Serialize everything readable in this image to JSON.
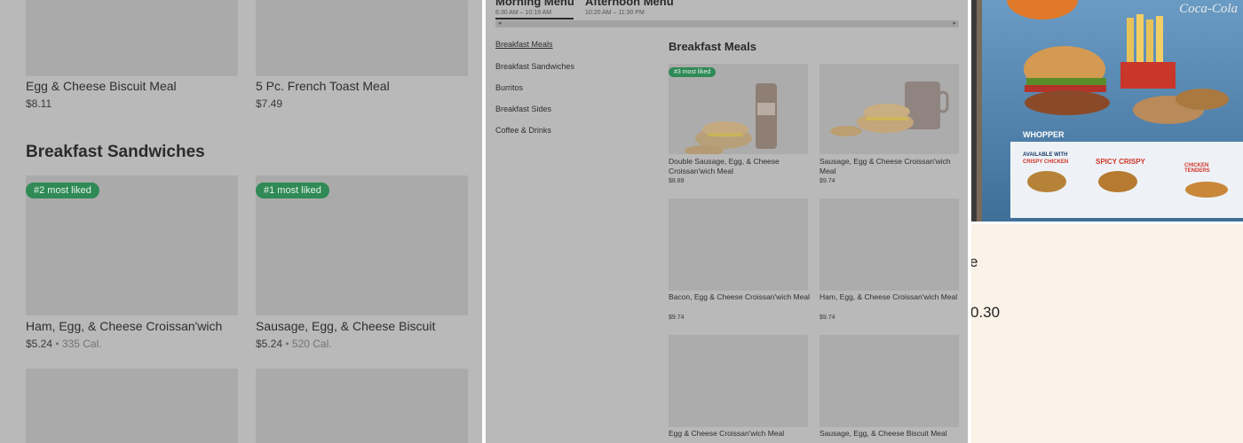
{
  "left_panel": {
    "top_items": [
      {
        "name": "Egg & Cheese Biscuit Meal",
        "price": "$8.11"
      },
      {
        "name": "5 Pc. French Toast Meal",
        "price": "$7.49"
      }
    ],
    "section_title": "Breakfast Sandwiches",
    "sandwiches": [
      {
        "badge": "#2 most liked",
        "name": "Ham, Egg, & Cheese Croissan'wich",
        "price": "$5.24",
        "cal": "• 335 Cal."
      },
      {
        "badge": "#1 most liked",
        "name": "Sausage, Egg, & Cheese Biscuit",
        "price": "$5.24",
        "cal": "• 520 Cal."
      }
    ]
  },
  "middle_panel": {
    "tabs": [
      {
        "title": "Morning Menu",
        "time": "6:30 AM – 10:19 AM"
      },
      {
        "title": "Afternoon Menu",
        "time": "10:20 AM – 11:30 PM"
      }
    ],
    "categories": [
      "Breakfast Meals",
      "Breakfast Sandwiches",
      "Burritos",
      "Breakfast Sides",
      "Coffee & Drinks"
    ],
    "section_title": "Breakfast Meals",
    "badge": "#3 most liked",
    "items": [
      {
        "name": "Double Sausage, Egg, & Cheese Croissan'wich Meal",
        "price": "$8.89"
      },
      {
        "name": "Sausage, Egg & Cheese Croissan'wich Meal",
        "price": "$9.74"
      },
      {
        "name": "Bacon, Egg & Cheese Croissan'wich Meal",
        "price": "$9.74"
      },
      {
        "name": "Ham, Egg, & Cheese Croissan'wich Meal",
        "price": "$9.74"
      },
      {
        "name": "Egg & Cheese Croissan'wich Meal",
        "price": ""
      },
      {
        "name": "Sausage, Egg, & Cheese Biscuit Meal",
        "price": ""
      }
    ]
  },
  "right_panel": {
    "photo": {
      "brand": "Coca-Cola",
      "label": "WHOPPER",
      "available": "AVAILABLE WITH",
      "chicken1": "CRISPY CHICKEN",
      "chicken2": "SPICY CRISPY",
      "chicken3": "CHICKEN TENDERS"
    },
    "snippet_title": "e",
    "snippet_price": "0.30"
  }
}
